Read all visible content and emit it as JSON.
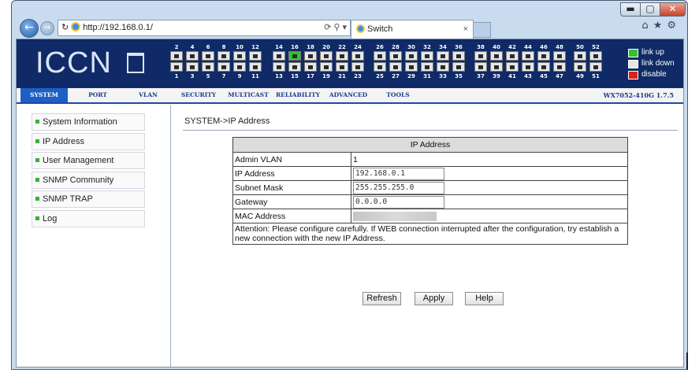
{
  "browser": {
    "address": "http://192.168.0.1/",
    "tab_title": "Switch",
    "tab_close": "×",
    "window_controls": {
      "minimize": "▬",
      "maximize": "▢",
      "close": "✕"
    },
    "toolbar_icons": [
      "home-icon",
      "star-icon",
      "gear-icon"
    ]
  },
  "banner": {
    "logo": "ICCN",
    "port_groups": [
      {
        "top": [
          "2",
          "4",
          "6",
          "8",
          "10",
          "12"
        ],
        "bottom": [
          "1",
          "3",
          "5",
          "7",
          "9",
          "11"
        ]
      },
      {
        "top": [
          "14",
          "16",
          "18",
          "20",
          "22",
          "24"
        ],
        "bottom": [
          "13",
          "15",
          "17",
          "19",
          "21",
          "23"
        ]
      },
      {
        "top": [
          "26",
          "28",
          "30",
          "32",
          "34",
          "36"
        ],
        "bottom": [
          "25",
          "27",
          "29",
          "31",
          "33",
          "35"
        ]
      },
      {
        "top": [
          "38",
          "40",
          "42",
          "44",
          "46",
          "48"
        ],
        "bottom": [
          "37",
          "39",
          "41",
          "43",
          "45",
          "47"
        ]
      },
      {
        "top": [
          "50",
          "52"
        ],
        "bottom": [
          "49",
          "51"
        ]
      }
    ],
    "link_up_ports": [
      "16"
    ],
    "legend": [
      {
        "label": "link up",
        "color": "#34c130"
      },
      {
        "label": "link down",
        "color": "#e6e6e6"
      },
      {
        "label": "disable",
        "color": "#d9231b"
      }
    ]
  },
  "menu": {
    "items": [
      "SYSTEM",
      "PORT",
      "VLAN",
      "SECURITY",
      "MULTICAST",
      "RELIABILITY",
      "ADVANCED",
      "TOOLS"
    ],
    "active": "SYSTEM",
    "version": "WX7052-410G 1.7.5"
  },
  "sidebar": {
    "items": [
      "System Information",
      "IP Address",
      "User Management",
      "SNMP Community",
      "SNMP TRAP",
      "Log"
    ]
  },
  "main": {
    "breadcrumb": "SYSTEM->IP Address",
    "table_title": "IP Address",
    "admin_vlan_label": "Admin VLAN",
    "admin_vlan_value": "1",
    "ip_label": "IP Address",
    "ip_value": "192.168.0.1",
    "mask_label": "Subnet Mask",
    "mask_value": "255.255.255.0",
    "gateway_label": "Gateway",
    "gateway_value": "0.0.0.0",
    "mac_label": "MAC Address",
    "attention": "Attention: Please configure carefully. If WEB connection interrupted after the configuration, try establish a new connection with the new IP Address.",
    "buttons": {
      "refresh": "Refresh",
      "apply": "Apply",
      "help": "Help"
    }
  }
}
